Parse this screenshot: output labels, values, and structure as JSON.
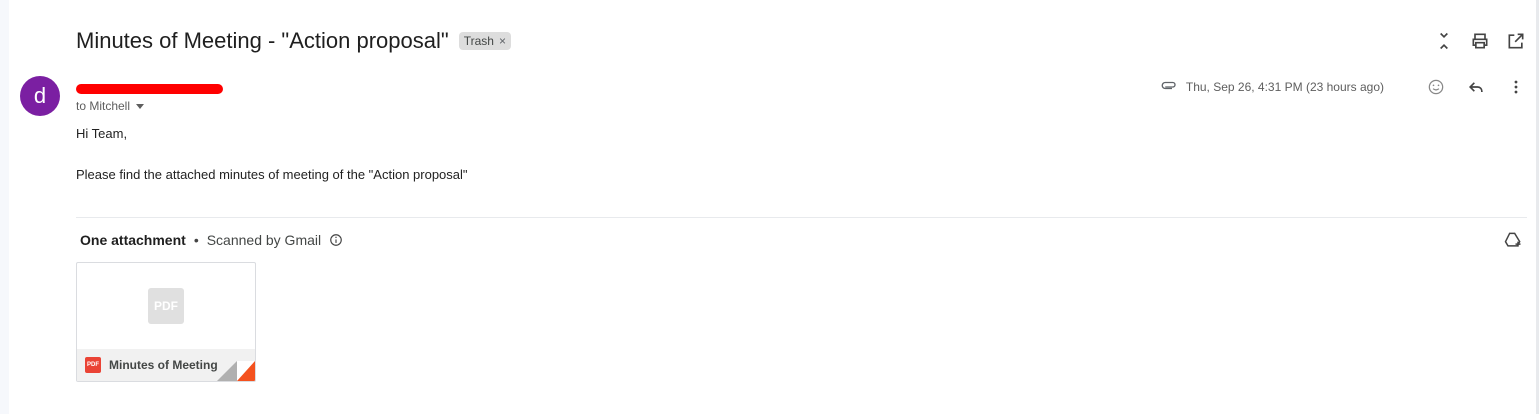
{
  "email": {
    "subject": "Minutes of Meeting - \"Action proposal\"",
    "label": "Trash",
    "label_remove": "×",
    "avatar_letter": "d",
    "to_line": "to Mitchell",
    "date": "Thu, Sep 26, 4:31 PM (23 hours ago)",
    "body": {
      "greeting": "Hi  Team,",
      "line1": "Please find the attached minutes of meeting of the \"Action proposal\""
    }
  },
  "attachments": {
    "count_label": "One attachment",
    "separator": "•",
    "scan_label": "Scanned by Gmail",
    "items": [
      {
        "name": "Minutes of Meeting",
        "thumb_label": "PDF",
        "badge": "PDF"
      }
    ]
  },
  "icons": {
    "top": [
      "collapse-icon",
      "print-icon",
      "open-in-new-window-icon"
    ],
    "message": [
      "attachment-icon",
      "emoji-icon",
      "reply-icon",
      "more-vert-icon"
    ],
    "attachment": [
      "info-icon",
      "add-to-drive-icon"
    ]
  },
  "colors": {
    "avatar": "#7b1fa2",
    "redaction": "#ff0000",
    "pdf": "#ea4335"
  }
}
